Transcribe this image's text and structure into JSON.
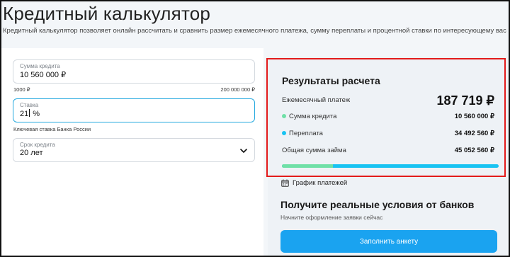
{
  "header": {
    "title": "Кредитный калькулятор",
    "subtitle": "Кредитный калькулятор позволяет онлайн рассчитать и сравнить размер ежемесячного платежа, сумму переплаты и процентной ставки по интересующему вас кредиту."
  },
  "form": {
    "loan_amount": {
      "label": "Сумма кредита",
      "value": "10 560 000 ₽",
      "min_label": "1000 ₽",
      "max_label": "200 000 000 ₽"
    },
    "rate": {
      "label": "Ставка",
      "value_before_caret": "21",
      "value_after_caret": " %",
      "hint": "Ключевая ставка Банка России"
    },
    "term": {
      "label": "Срок кредита",
      "value": "20 лет"
    }
  },
  "results": {
    "title": "Результаты расчета",
    "monthly_payment_label": "Ежемесячный платеж",
    "monthly_payment_value": "187 719 ₽",
    "loan_amount_label": "Сумма кредита",
    "loan_amount_value": "10 560 000 ₽",
    "overpayment_label": "Переплата",
    "overpayment_value": "34 492 560 ₽",
    "total_label": "Общая сумма займа",
    "total_value": "45 052 560 ₽",
    "loan_share_fraction": 0.234,
    "colors": {
      "loan": "#6fe0a7",
      "overpayment": "#18c3f2",
      "highlight_border": "#e31b1b"
    }
  },
  "schedule": {
    "label": "График платежей",
    "icon": "calendar-icon"
  },
  "cta": {
    "title": "Получите реальные условия от банков",
    "subtitle": "Начните оформление заявки сейчас",
    "button_label": "Заполнить анкету",
    "button_color": "#1aa3f0"
  }
}
